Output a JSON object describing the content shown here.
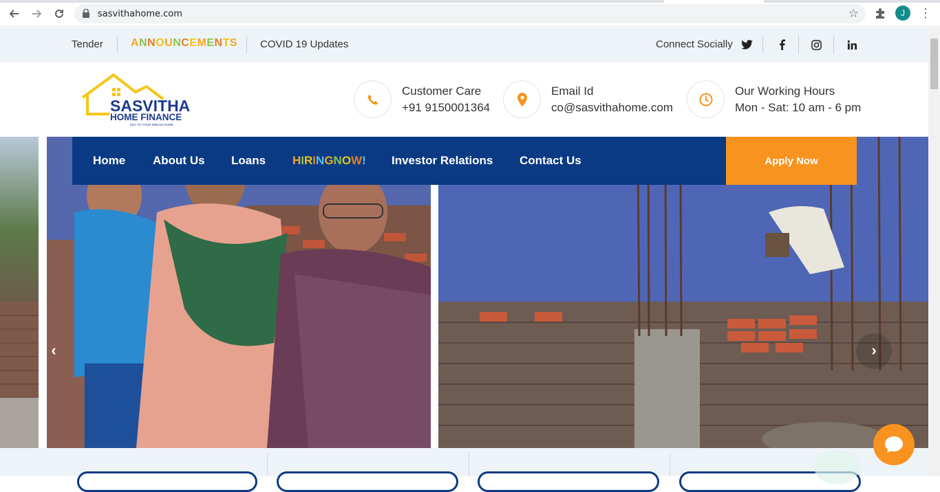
{
  "browser": {
    "url": "sasvithahome.com",
    "profile_initial": "J"
  },
  "topbar": {
    "tender": "Tender",
    "announcements": "ANNOUNCEMENTS",
    "covid": "COVID 19 Updates",
    "connect": "Connect Socially",
    "social_icons": [
      "twitter-icon",
      "facebook-icon",
      "instagram-icon",
      "linkedin-icon"
    ]
  },
  "logo": {
    "line1": "SASVITHA",
    "line2": "HOME FINANCE",
    "tagline": "KEY TO YOUR DREAM HOME"
  },
  "contact": {
    "care_label": "Customer Care",
    "care_value": "+91 9150001364",
    "email_label": "Email Id",
    "email_value": "co@sasvithahome.com",
    "hours_label": "Our Working Hours",
    "hours_value": "Mon - Sat: 10 am - 6 pm"
  },
  "nav": {
    "home": "Home",
    "about": "About Us",
    "loans": "Loans",
    "hiring": "HIRINGNOW!",
    "investor": "Investor Relations",
    "contact": "Contact Us",
    "apply": "Apply Now"
  },
  "colors": {
    "navy": "#0a3a84",
    "orange": "#f7931e",
    "topbar_bg": "#eef3f8"
  }
}
